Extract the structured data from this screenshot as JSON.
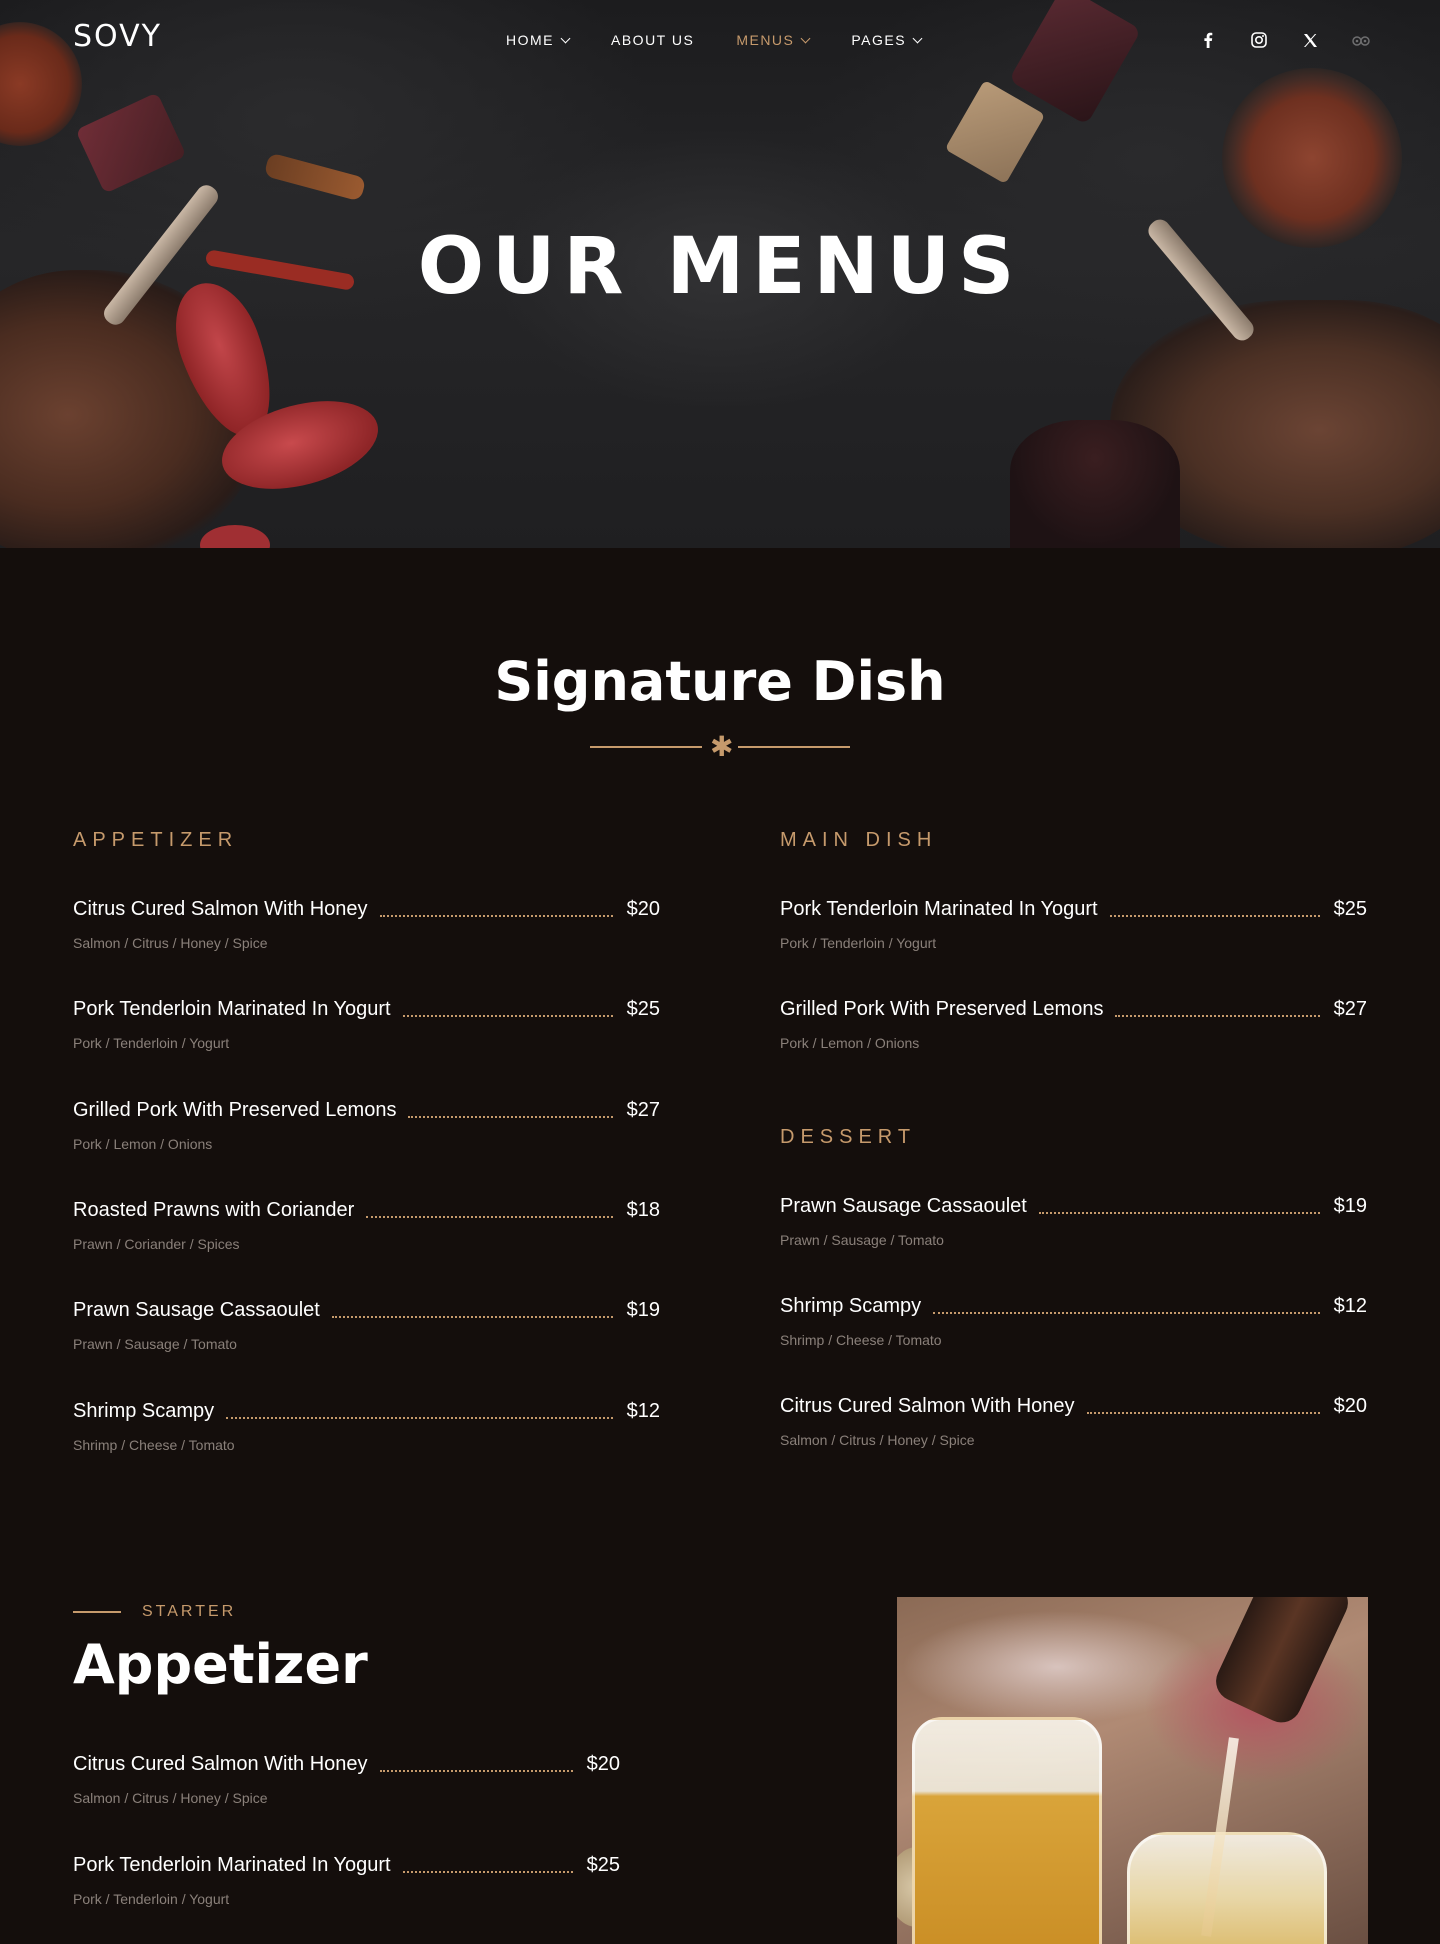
{
  "brand": {
    "logo": "SOVY"
  },
  "nav": {
    "items": [
      {
        "label": "HOME",
        "dropdown": true
      },
      {
        "label": "ABOUT US",
        "dropdown": false
      },
      {
        "label": "MENUS",
        "dropdown": true,
        "active": true
      },
      {
        "label": "PAGES",
        "dropdown": true
      }
    ],
    "socials": [
      "facebook-icon",
      "instagram-icon",
      "x-twitter-icon",
      "tripadvisor-icon"
    ]
  },
  "hero": {
    "title": "OUR MENUS"
  },
  "signature": {
    "title": "Signature Dish",
    "appetizer": {
      "label": "APPETIZER",
      "items": [
        {
          "name": "Citrus Cured Salmon With Honey",
          "price": "$20",
          "ingredients": "Salmon / Citrus / Honey / Spice"
        },
        {
          "name": "Pork Tenderloin Marinated In Yogurt",
          "price": "$25",
          "ingredients": "Pork / Tenderloin / Yogurt"
        },
        {
          "name": "Grilled Pork With Preserved Lemons",
          "price": "$27",
          "ingredients": "Pork / Lemon / Onions"
        },
        {
          "name": "Roasted Prawns with Coriander",
          "price": "$18",
          "ingredients": "Prawn / Coriander / Spices"
        },
        {
          "name": "Prawn Sausage Cassaoulet",
          "price": "$19",
          "ingredients": "Prawn / Sausage / Tomato"
        },
        {
          "name": "Shrimp Scampy",
          "price": "$12",
          "ingredients": "Shrimp / Cheese / Tomato"
        }
      ]
    },
    "main": {
      "label": "MAIN DISH",
      "items": [
        {
          "name": "Pork Tenderloin Marinated In Yogurt",
          "price": "$25",
          "ingredients": "Pork / Tenderloin / Yogurt"
        },
        {
          "name": "Grilled Pork With Preserved Lemons",
          "price": "$27",
          "ingredients": "Pork / Lemon / Onions"
        }
      ]
    },
    "dessert": {
      "label": "DESSERT",
      "items": [
        {
          "name": "Prawn Sausage Cassaoulet",
          "price": "$19",
          "ingredients": "Prawn / Sausage / Tomato"
        },
        {
          "name": "Shrimp Scampy",
          "price": "$12",
          "ingredients": "Shrimp / Cheese / Tomato"
        },
        {
          "name": "Citrus Cured Salmon With Honey",
          "price": "$20",
          "ingredients": "Salmon / Citrus / Honey / Spice"
        }
      ]
    }
  },
  "starter": {
    "label": "STARTER",
    "title": "Appetizer",
    "items": [
      {
        "name": "Citrus Cured Salmon With Honey",
        "price": "$20",
        "ingredients": "Salmon / Citrus / Honey / Spice"
      },
      {
        "name": "Pork Tenderloin Marinated In Yogurt",
        "price": "$25",
        "ingredients": "Pork / Tenderloin / Yogurt"
      }
    ]
  },
  "colors": {
    "accent": "#c69a6c",
    "background": "#140e0c",
    "muted": "#8a807a"
  }
}
